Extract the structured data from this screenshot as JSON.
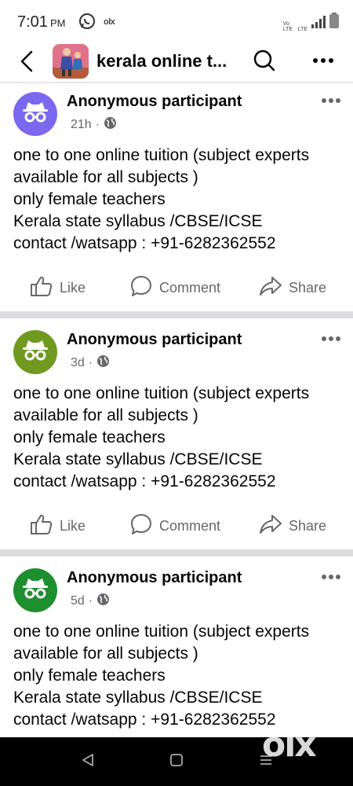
{
  "status_bar": {
    "time": "7:01",
    "ampm": "PM",
    "net_label_1": "Vo LTE",
    "net_label_2": "LTE"
  },
  "header": {
    "title": "kerala online t...",
    "icons": [
      "back-arrow-icon",
      "search-icon",
      "more-dots-icon"
    ]
  },
  "posts": [
    {
      "author": "Anonymous participant",
      "time": "21h",
      "avatar_color": "#7b68ee",
      "lines": [
        "one to one online tuition (subject experts",
        "available for all subjects )",
        "only female teachers",
        "Kerala state syllabus /CBSE/ICSE",
        "contact /watsapp : +91-6282362552"
      ]
    },
    {
      "author": "Anonymous participant",
      "time": "3d",
      "avatar_color": "#6f9a1f",
      "lines": [
        "one to one online tuition (subject experts",
        "available for all subjects )",
        "only female teachers",
        "Kerala state syllabus /CBSE/ICSE",
        "contact /watsapp : +91-6282362552"
      ]
    },
    {
      "author": "Anonymous participant",
      "time": "5d",
      "avatar_color": "#1e8f2f",
      "lines": [
        "one to one online tuition (subject experts",
        "available for all subjects )",
        "only female teachers",
        "Kerala state syllabus /CBSE/ICSE",
        "contact /watsapp : +91-6282362552"
      ]
    }
  ],
  "actions": {
    "like": "Like",
    "comment": "Comment",
    "share": "Share"
  },
  "watermark": {
    "brand": "olx"
  }
}
